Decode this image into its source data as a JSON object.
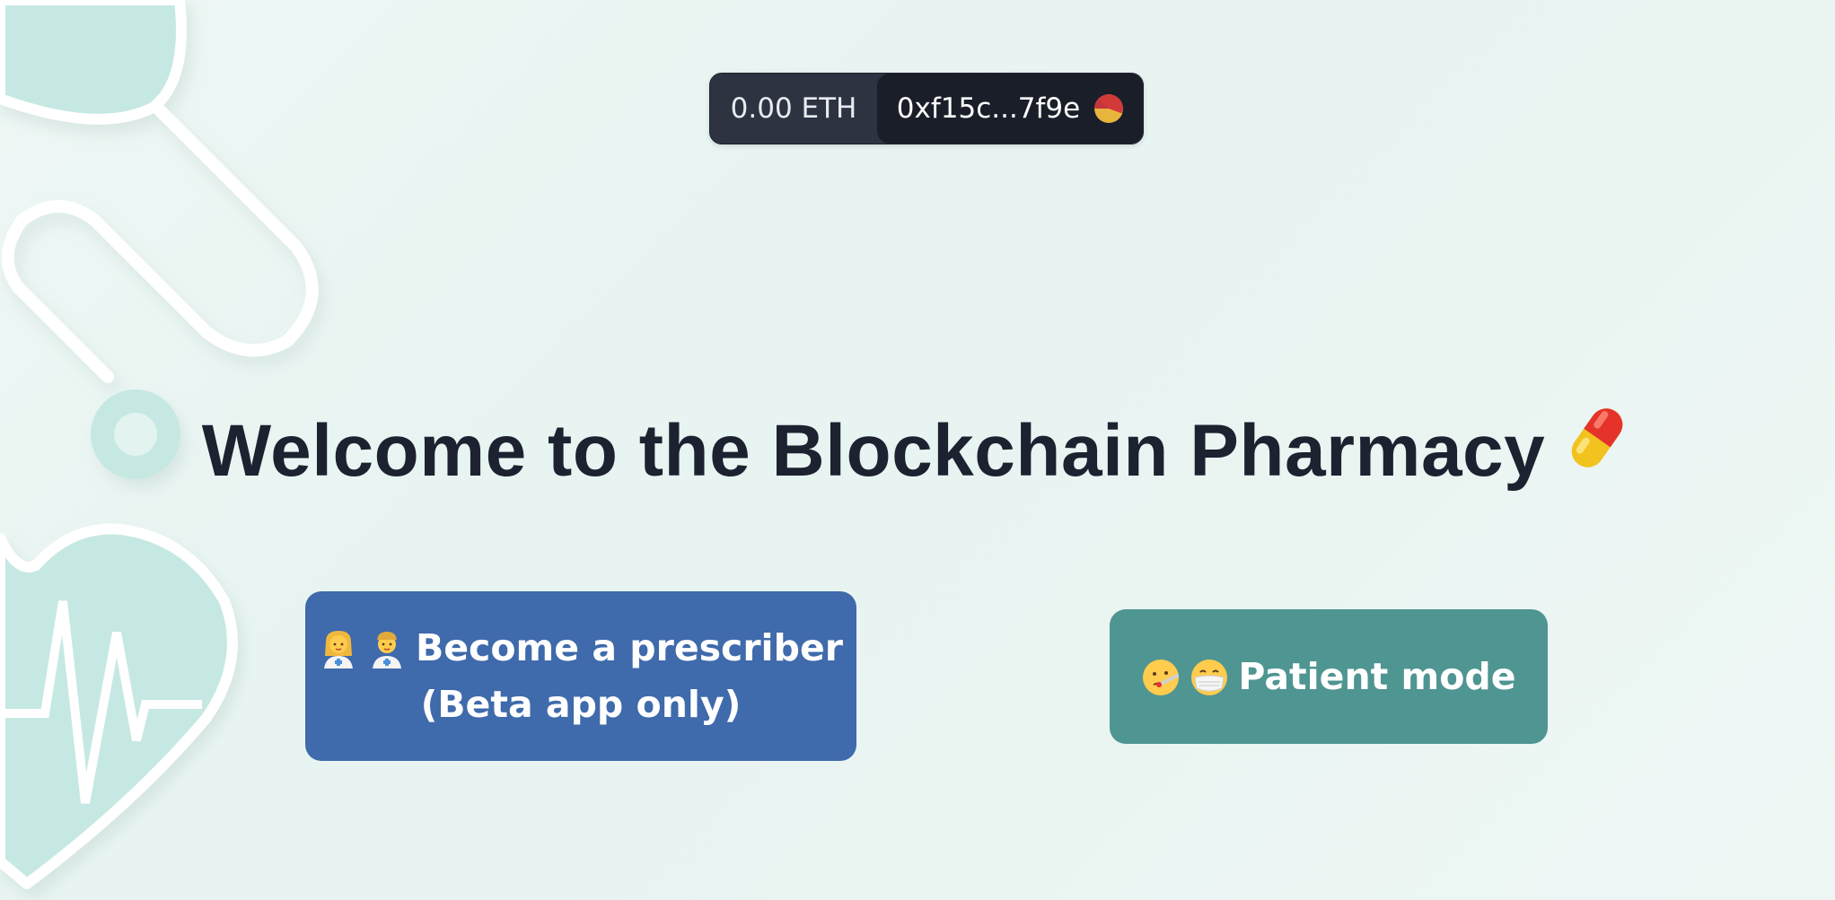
{
  "wallet": {
    "balance": "0.00 ETH",
    "address": "0xf15c...7f9e",
    "avatar_icon": "account-avatar-icon"
  },
  "main": {
    "title": "Welcome to the Blockchain Pharmacy",
    "title_icon": "pill-icon",
    "prescriber_button": {
      "line1": "Become a prescriber",
      "line2": "(Beta app only)",
      "icons": [
        "woman-health-worker-icon",
        "man-health-worker-icon"
      ]
    },
    "patient_button": {
      "label": "Patient mode",
      "icons": [
        "face-with-thermometer-icon",
        "face-with-medical-mask-icon"
      ]
    }
  },
  "colors": {
    "background": "#e9f5f2",
    "decor": "#c5e7e2",
    "wallet_bg": "#2d3340",
    "wallet_address_bg": "#1a1e28",
    "title": "#1c2230",
    "prescriber_button": "#3f6aab",
    "patient_button": "#4f9592"
  }
}
